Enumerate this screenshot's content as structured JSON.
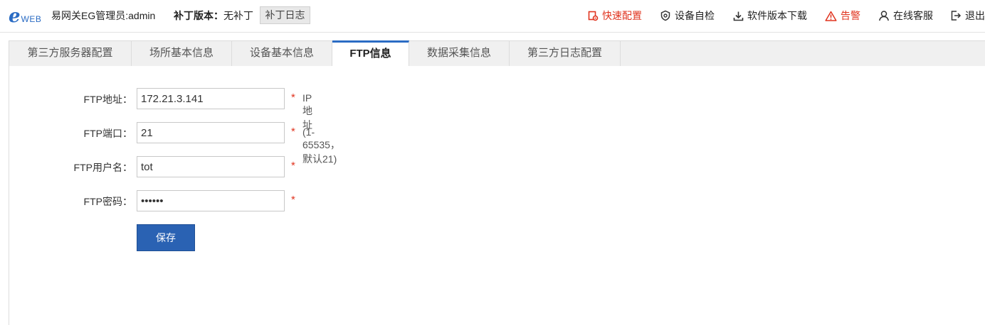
{
  "header": {
    "logo_mark": "e",
    "logo_text": "WEB",
    "brand": "易网关EG管理员:admin",
    "patch_label": "补丁版本：",
    "patch_value": "无补丁",
    "patch_log_button": "补丁日志",
    "nav": [
      {
        "label": "快速配置",
        "icon": "quick-config-icon",
        "color": "#e0341f"
      },
      {
        "label": "设备自检",
        "icon": "device-check-icon"
      },
      {
        "label": "软件版本下载",
        "icon": "download-icon"
      },
      {
        "label": "告警",
        "icon": "warning-icon",
        "color": "#e0341f"
      },
      {
        "label": "在线客服",
        "icon": "user-icon"
      },
      {
        "label": "退出",
        "icon": "logout-icon"
      }
    ]
  },
  "tabs": [
    {
      "label": "第三方服务器配置"
    },
    {
      "label": "场所基本信息"
    },
    {
      "label": "设备基本信息"
    },
    {
      "label": "FTP信息",
      "active": true
    },
    {
      "label": "数据采集信息"
    },
    {
      "label": "第三方日志配置"
    }
  ],
  "form": {
    "ftp_address": {
      "label": "FTP地址：",
      "value": "172.21.3.141",
      "required": "*",
      "hint": "IP地址"
    },
    "ftp_port": {
      "label": "FTP端口：",
      "value": "21",
      "required": "*",
      "hint": "(1-65535，默认21)"
    },
    "ftp_user": {
      "label": "FTP用户名：",
      "value": "tot",
      "required": "*"
    },
    "ftp_password": {
      "label": "FTP密码：",
      "value": "123456",
      "required": "*"
    },
    "save_button": "保存"
  },
  "colors": {
    "accent": "#2b6cc4",
    "button": "#2a62b3",
    "alert": "#e0341f"
  }
}
